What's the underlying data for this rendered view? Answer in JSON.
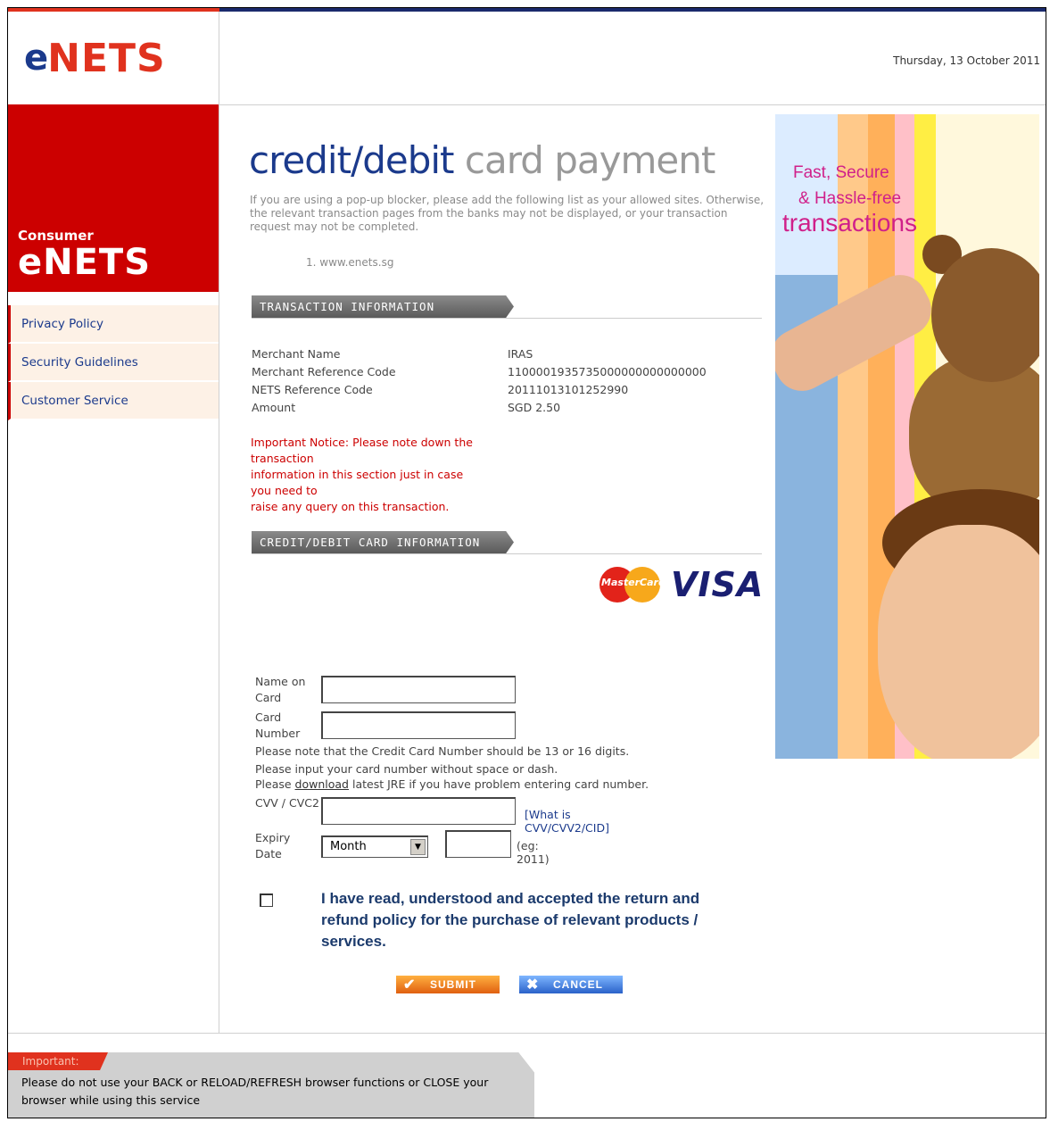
{
  "brand": {
    "logo_e": "e",
    "logo_nets": "NETS",
    "consumer_small": "Consumer",
    "consumer_big": "eNETS"
  },
  "header": {
    "date": "Thursday, 13 October 2011"
  },
  "sidebar": {
    "items": [
      {
        "label": "Privacy Policy"
      },
      {
        "label": "Security Guidelines"
      },
      {
        "label": "Customer Service"
      }
    ]
  },
  "main": {
    "title_a": "credit/debit",
    "title_b": " card payment",
    "intro": "If you are using a pop-up blocker, please add the following list as your allowed sites. Otherwise, the relevant transaction pages from the banks may not be displayed, or your transaction request may not be completed.",
    "site": "1.  www.enets.sg",
    "transaction_header": "TRANSACTION INFORMATION",
    "card_header": "CREDIT/DEBIT CARD INFORMATION",
    "transaction": [
      {
        "label": "Merchant Name",
        "value": "IRAS"
      },
      {
        "label": "Merchant Reference Code",
        "value": "1100001935735000000000000000"
      },
      {
        "label": "NETS Reference Code",
        "value": "20111013101252990"
      },
      {
        "label": "Amount",
        "value": "SGD 2.50"
      }
    ],
    "notice_lines": [
      "Important Notice: Please note down the",
      "transaction",
      "information in this section just in case",
      "you need to",
      "raise any query on this transaction."
    ],
    "card_logos": {
      "mastercard": "MasterCard",
      "visa": "VISA"
    }
  },
  "form": {
    "name_label": "Name on Card",
    "name_value": "",
    "number_label": "Card Number",
    "number_value": "",
    "note1": "Please note that the Credit Card Number should be 13 or 16 digits.",
    "note2": "Please input your card number without space or dash.",
    "note3_pre": "Please ",
    "note3_link": "download",
    "note3_post": " latest JRE if you have problem entering card number.",
    "cvv_label": "CVV / CVC2",
    "cvv_value": "",
    "cvv_link": "[What is CVV/CVV2/CID]",
    "expiry_label": "Expiry Date",
    "month_selected": "Month",
    "year_value": "",
    "year_hint": "(eg: 2011)",
    "agree_text": "I have read, understood and accepted the return and refund policy for the purchase of relevant products / services.",
    "submit_label": "SUBMIT",
    "cancel_label": "CANCEL"
  },
  "banner": {
    "line1": "Fast, Secure",
    "line2": "& Hassle-free",
    "line3": "transactions"
  },
  "footer": {
    "tab": "Important:",
    "text": "Please do not use your BACK or RELOAD/REFRESH browser functions or CLOSE your browser while using this service"
  },
  "colors": {
    "brand_red": "#cc0000",
    "brand_blue": "#1b3a8c",
    "notice_red": "#cc0000"
  }
}
